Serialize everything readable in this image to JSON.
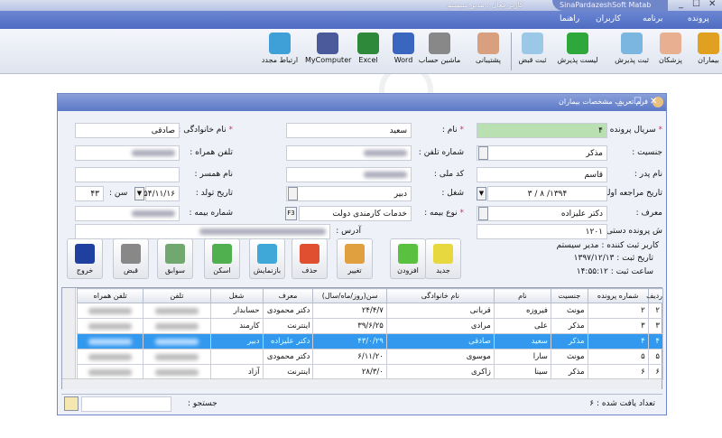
{
  "logo": {
    "text_a": "digi",
    "text_b": "kala"
  },
  "window": {
    "app_title": "SinaPardazeshSoft Matab",
    "active_user": "کاربر فعال : مدیر سیستم",
    "min": "_",
    "max": "☐",
    "close": "✕"
  },
  "menu": [
    "پرونده",
    "برنامه",
    "کاربران",
    "راهنما"
  ],
  "toolbar": [
    {
      "label": "بیماران",
      "icon": "address-book-icon",
      "color": "#e0a020"
    },
    {
      "label": "پزشکان",
      "icon": "doctor-icon",
      "color": "#e8b090"
    },
    {
      "label": "ثبت پذیرش",
      "icon": "register-icon",
      "color": "#7ab6e0"
    },
    {
      "label": "لیست پذیرش",
      "icon": "check-icon",
      "color": "#2ea83a"
    },
    {
      "label": "ثبت قبض",
      "icon": "cash-icon",
      "color": "#9cc8e8"
    },
    {
      "label": "پشتیبانی",
      "icon": "support-icon",
      "color": "#d9a080"
    },
    {
      "label": "ماشین حساب",
      "icon": "calculator-icon",
      "color": "#888"
    },
    {
      "label": "Word",
      "icon": "word-icon",
      "color": "#3a66c0"
    },
    {
      "label": "Excel",
      "icon": "excel-icon",
      "color": "#2e8a3a"
    },
    {
      "label": "MyComputer",
      "icon": "computer-icon",
      "color": "#4a5a9a"
    },
    {
      "label": "ارتباط مجدد",
      "icon": "refresh-icon",
      "color": "#3fa0d8"
    }
  ],
  "dialog": {
    "title": "فرم تعریف مشخصات بیماران",
    "fields": {
      "serial": {
        "label": "سریال پرونده :",
        "value": "۴"
      },
      "name": {
        "label": "نام :",
        "value": "سعید"
      },
      "family": {
        "label": "نام خانوادگی :",
        "value": "صادقی"
      },
      "gender": {
        "label": "جنسیت :",
        "value": "مذکر"
      },
      "phone": {
        "label": "شماره تلفن :"
      },
      "mobile": {
        "label": "تلفن همراه :"
      },
      "father": {
        "label": "نام پدر :",
        "value": "قاسم"
      },
      "national": {
        "label": "کد ملی :"
      },
      "spouse": {
        "label": "نام همسر :",
        "value": ""
      },
      "first_visit": {
        "label": "تاریخ مراجعه اولیه :",
        "value": "۱۳۹۴/ ۸ / ۳"
      },
      "job": {
        "label": "شغل :",
        "value": "دبیر"
      },
      "birth": {
        "label": "تاریخ تولد :",
        "value": "۱۳۵۴/۱۱/۱۶"
      },
      "age": {
        "label": "سن :",
        "value": "۴۳"
      },
      "referrer": {
        "label": "معرف :",
        "value": "دکتر علیزاده"
      },
      "insurance": {
        "label": "نوع بیمه :",
        "value": "خدمات کارمندی دولت",
        "key": "F3"
      },
      "insurance_no": {
        "label": "شماره بیمه :"
      },
      "manual_no": {
        "label": "ش پرونده دستی :",
        "value": "۱۲۰۱"
      },
      "address": {
        "label": "آدرس :"
      }
    },
    "info": {
      "creator": "کاربر ثبت کننده : مدیر سیستم",
      "date": "تاریخ ثبت : ۱۳۹۷/۱۲/۱۳",
      "time": "ساعت ثبت : ۱۴:۵۵:۱۲"
    },
    "buttons": [
      {
        "label": "جدید",
        "icon": "new-icon",
        "color": "#e8d840"
      },
      {
        "label": "افزودن",
        "icon": "add-icon",
        "color": "#5ac040"
      },
      {
        "label": "تغییر",
        "icon": "edit-icon",
        "color": "#e0a040"
      },
      {
        "label": "حذف",
        "icon": "delete-icon",
        "color": "#e05030"
      },
      {
        "label": "بازنمایش",
        "icon": "refresh-icon",
        "color": "#40a8d8"
      },
      {
        "label": "اسکن",
        "icon": "scan-icon",
        "color": "#50b050"
      },
      {
        "label": "سوابق",
        "icon": "history-icon",
        "color": "#70a870"
      },
      {
        "label": "قبض",
        "icon": "calculator-icon",
        "color": "#888"
      },
      {
        "label": "خروج",
        "icon": "power-icon",
        "color": "#2040a0"
      }
    ],
    "table": {
      "columns": [
        "ردیف",
        "شماره پرونده",
        "جنسیت",
        "نام",
        "نام خانوادگی",
        "سن(روز/ماه/سال)",
        "معرف",
        "شغل",
        "تلفن",
        "تلفن همراه"
      ],
      "rows": [
        [
          "۲",
          "۲",
          "مونث",
          "فیروزه",
          "قربانی",
          "۲۴/۴/۷",
          "دکتر محمودی",
          "حسابدار"
        ],
        [
          "۳",
          "۳",
          "مذکر",
          "علی",
          "مرادی",
          "۳۹/۶/۲۵",
          "اینترنت",
          "کارمند"
        ],
        [
          "۴",
          "۴",
          "مذکر",
          "سعید",
          "صادقی",
          "۴۳/۰/۲۹",
          "دکتر علیزاده",
          "دبیر"
        ],
        [
          "۵",
          "۵",
          "مونث",
          "سارا",
          "موسوی",
          "۶/۱۱/۲۰",
          "دکتر محمودی",
          ""
        ],
        [
          "۶",
          "۶",
          "مذکر",
          "سینا",
          "زاکری",
          "۲۸/۳/۰",
          "اینترنت",
          "آزاد"
        ]
      ],
      "selected_row": 2
    },
    "footer": {
      "count": "تعداد یافت شده : ۶",
      "search_label": "جستجو :",
      "search_value": ""
    }
  }
}
